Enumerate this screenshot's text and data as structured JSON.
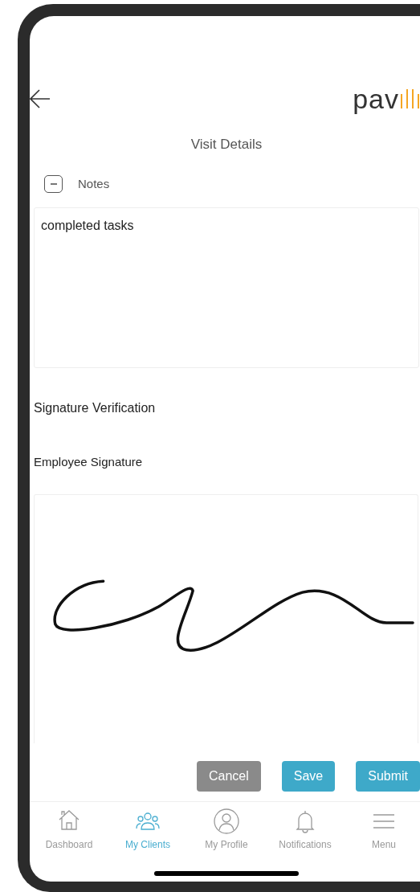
{
  "logo_text": "pav",
  "title": "Visit Details",
  "notes": {
    "label": "Notes",
    "expanded": true,
    "value": "completed tasks"
  },
  "signature_section": {
    "heading": "Signature Verification",
    "label": "Employee Signature",
    "signed": true
  },
  "actions": [
    {
      "label": "Cancel",
      "kind": "secondary"
    },
    {
      "label": "Save",
      "kind": "primary"
    },
    {
      "label": "Submit",
      "kind": "primary"
    }
  ],
  "nav": [
    {
      "label": "Dashboard",
      "selected": false
    },
    {
      "label": "My Clients",
      "selected": true
    },
    {
      "label": "My Profile",
      "selected": false
    },
    {
      "label": "Notifications",
      "selected": false
    },
    {
      "label": "Menu",
      "selected": false
    }
  ]
}
